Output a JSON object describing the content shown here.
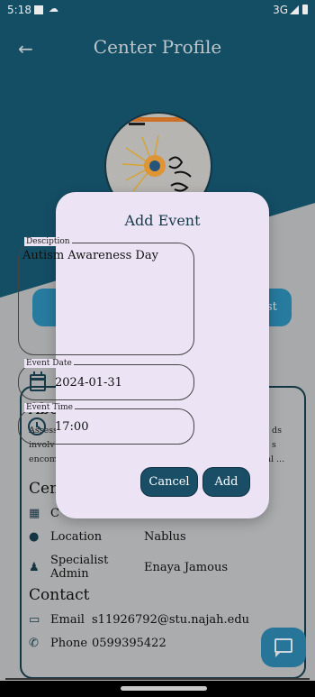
{
  "status_bar": {
    "time": "5:18",
    "network": "3G"
  },
  "header": {
    "title": "Center Profile"
  },
  "background": {
    "partial_button_text": "st",
    "about": {
      "heading": "Abo",
      "desc_lines": [
        "Assess",
        "involv",
        "encom"
      ],
      "desc_right": [
        "ds",
        "s",
        "cal ..."
      ]
    },
    "center": {
      "heading": "Cent",
      "partial_row": "C",
      "location_label": "Location",
      "location_value": "Nablus",
      "specialist_label": "Specialist Admin",
      "specialist_value": "Enaya Jamous"
    },
    "contact": {
      "heading": "Contact",
      "email_label": "Email",
      "email_value": "s11926792@stu.najah.edu",
      "phone_label": "Phone",
      "phone_value": "0599395422"
    }
  },
  "dialog": {
    "title": "Add Event",
    "description_label": "Desciption",
    "description_value": "Autism Awareness Day",
    "date_label": "Event Date",
    "date_value": "2024-01-31",
    "time_label": "Event Time",
    "time_value": "17:00",
    "cancel_label": "Cancel",
    "add_label": "Add"
  },
  "colors": {
    "primary": "#16556e",
    "dialog_bg": "#ece4f4",
    "button": "#1a4e67",
    "accent": "#2a86ad"
  }
}
